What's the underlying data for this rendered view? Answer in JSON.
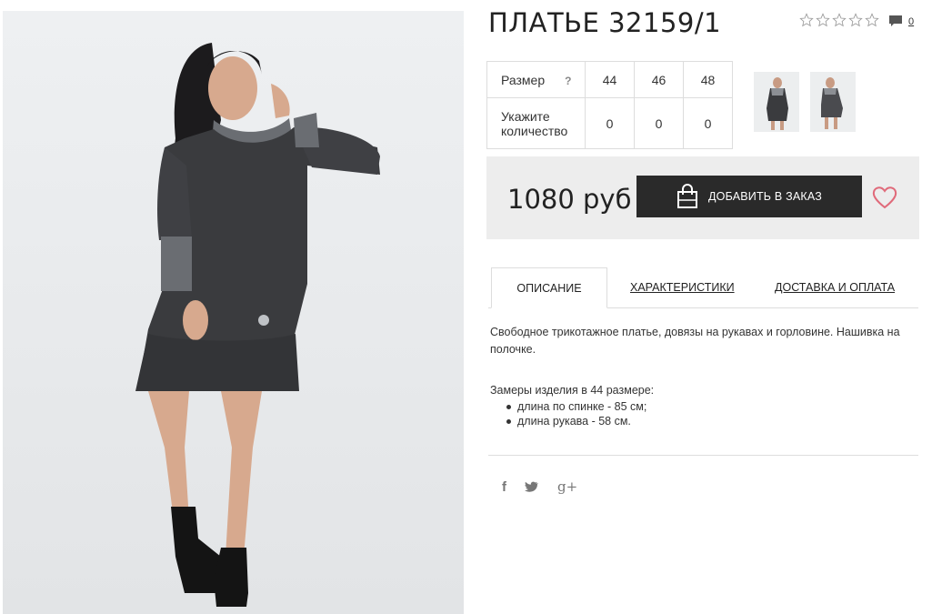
{
  "product": {
    "title": "ПЛАТЬЕ 32159/1",
    "rating_stars": 5,
    "comments_count": "0"
  },
  "sizes": {
    "size_label": "Размер",
    "help": "?",
    "quantity_label": "Укажите количество",
    "values": [
      "44",
      "46",
      "48"
    ],
    "quantities": [
      "0",
      "0",
      "0"
    ]
  },
  "buy": {
    "price": "1080 руб",
    "add_label": "ДОБАВИТЬ В ЗАКАЗ"
  },
  "tabs": {
    "description": "ОПИСАНИЕ",
    "specs": "ХАРАКТЕРИСТИКИ",
    "delivery": "ДОСТАВКА И ОПЛАТА"
  },
  "description": {
    "text": "Свободное трикотажное платье, довязы на рукавах и горловине. Нашивка на полочке.",
    "measure_title": "Замеры изделия в 44 размере:",
    "items": [
      "длина по спинке - 85 см;",
      "длина рукава - 58 см."
    ]
  },
  "social": {
    "facebook": "f",
    "twitter": "twitter-icon",
    "gplus": "g+"
  },
  "colors": {
    "dark_button": "#2a2a2a",
    "heart": "#e06a7a",
    "buybox_bg": "#ededed"
  }
}
